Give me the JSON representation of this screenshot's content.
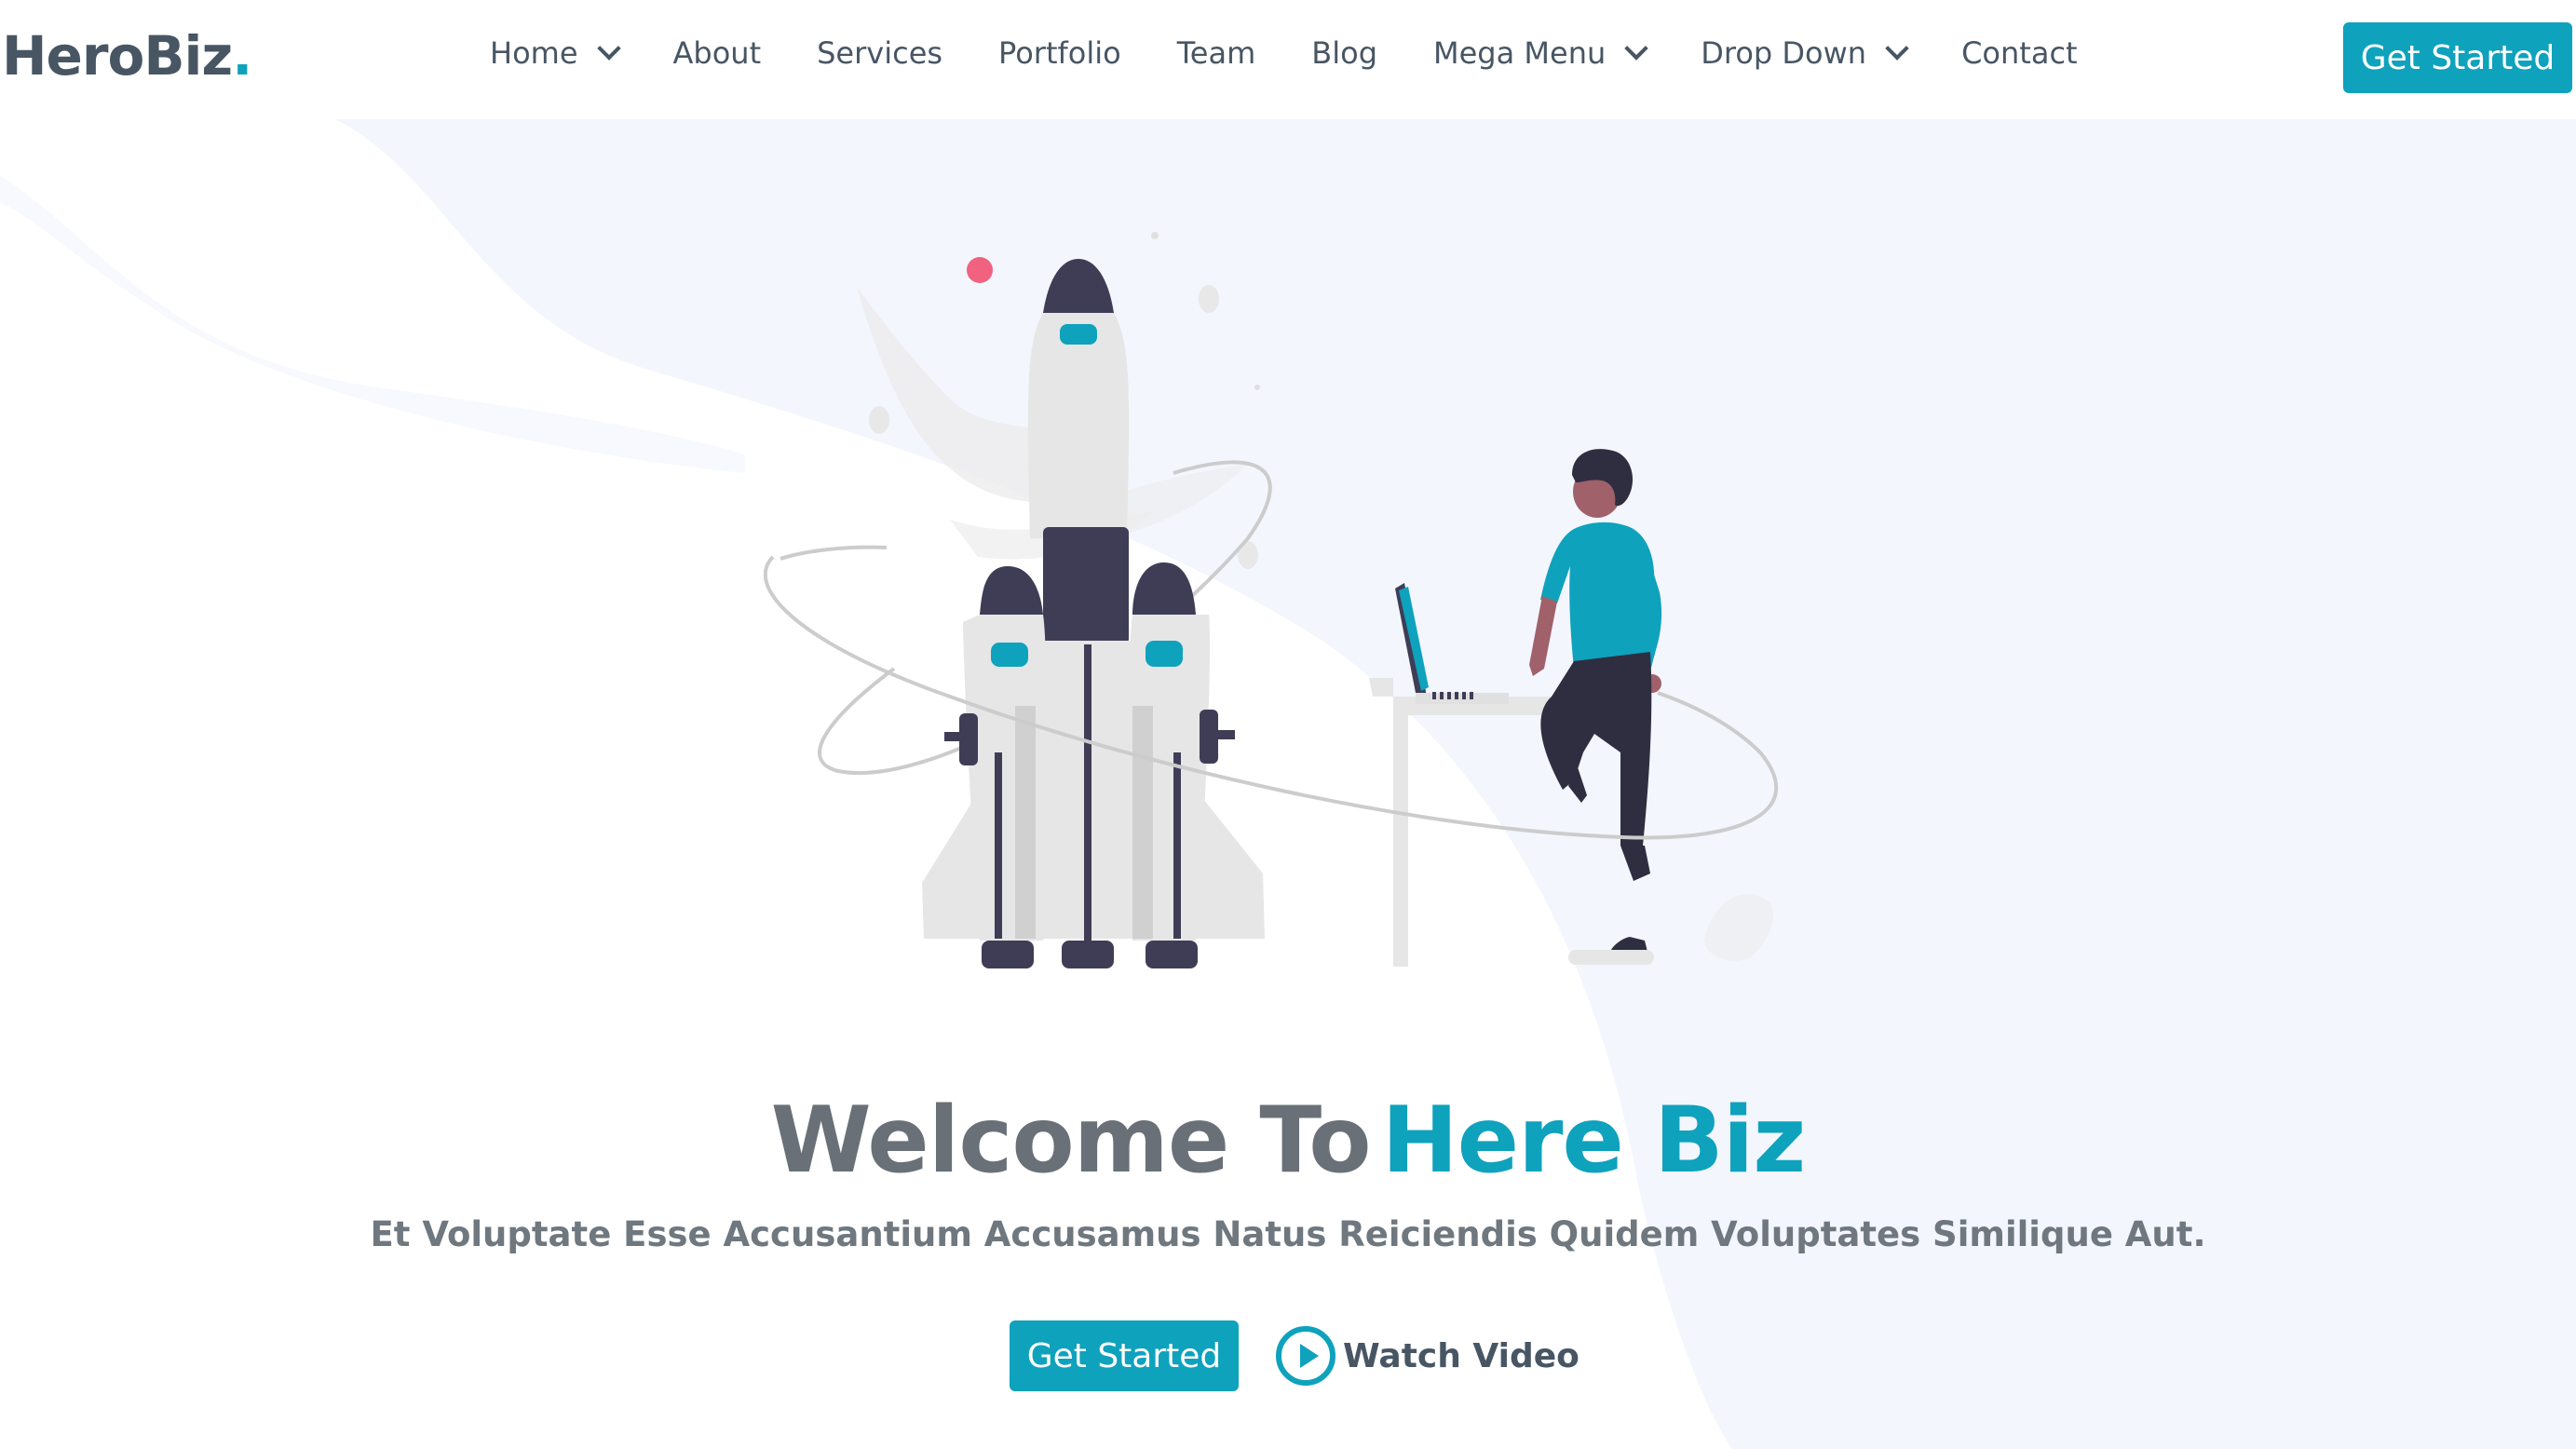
{
  "brand": {
    "name": "HeroBiz",
    "dot": "."
  },
  "nav": {
    "items": [
      {
        "label": "Home",
        "dropdown": true
      },
      {
        "label": "About",
        "dropdown": false
      },
      {
        "label": "Services",
        "dropdown": false
      },
      {
        "label": "Portfolio",
        "dropdown": false
      },
      {
        "label": "Team",
        "dropdown": false
      },
      {
        "label": "Blog",
        "dropdown": false
      },
      {
        "label": "Mega Menu",
        "dropdown": true
      },
      {
        "label": "Drop Down",
        "dropdown": true
      },
      {
        "label": "Contact",
        "dropdown": false
      }
    ],
    "cta_label": "Get Started"
  },
  "hero": {
    "title_part1": "Welcome To",
    "title_part2": "Here Biz",
    "subtitle": "Et Voluptate Esse Accusantium Accusamus Natus Reiciendis Quidem Voluptates Similique Aut.",
    "cta_label": "Get Started",
    "video_label": "Watch Video"
  },
  "icons": {
    "dropdown": "chevron-down-icon",
    "video": "play-circle-icon"
  },
  "colors": {
    "accent": "#0ea2bd",
    "heading": "#485664",
    "muted": "#6a7077",
    "hero_bg": "#f3f6fd"
  }
}
